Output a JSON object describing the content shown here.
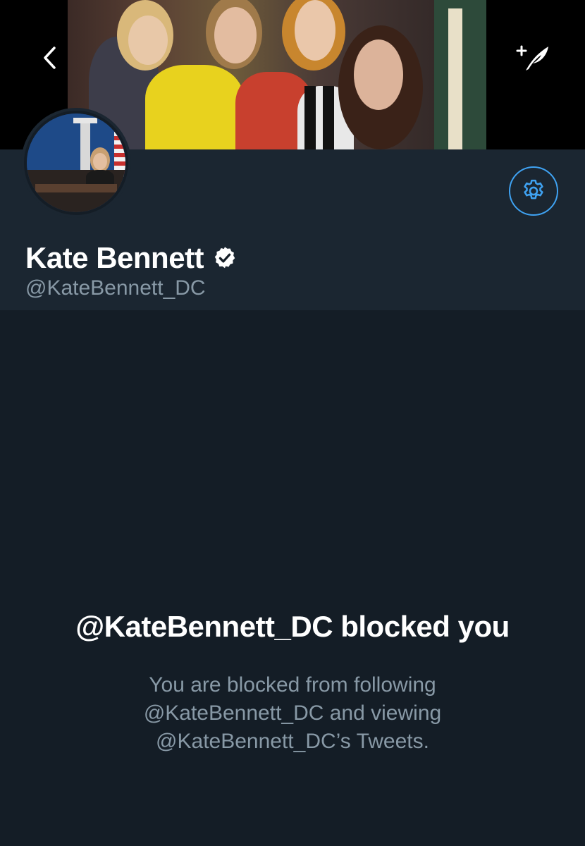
{
  "header": {
    "back_icon": "chevron-left-icon",
    "compose_icon": "compose-tweet-icon"
  },
  "profile": {
    "display_name": "Kate Bennett",
    "verified_icon": "verified-badge-icon",
    "handle": "@KateBennett_DC",
    "settings_icon": "gear-icon"
  },
  "blocked_notice": {
    "title": "@KateBennett_DC blocked you",
    "description": "You are blocked from following @KateBennett_DC and viewing @KateBennett_DC’s Tweets."
  },
  "colors": {
    "background": "#141d26",
    "profile_background": "#1b2631",
    "accent": "#3fa2f2",
    "secondary_text": "#8899a6"
  }
}
